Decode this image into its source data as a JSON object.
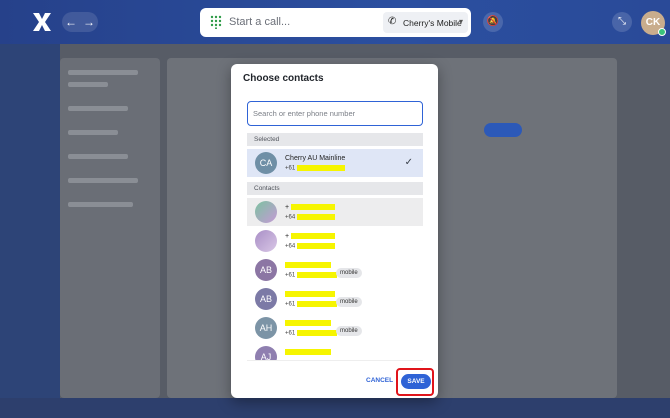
{
  "topbar": {
    "call_placeholder": "Start a call...",
    "line_label": "Cherry's Mobile",
    "user_initials": "CK",
    "icons": [
      "x-logo-icon",
      "back-arrow-icon",
      "forward-arrow-icon",
      "dialpad-icon",
      "phone-icon",
      "chevron-down-icon",
      "bell-off-icon",
      "collapse-icon"
    ]
  },
  "dialog": {
    "title": "Choose contacts",
    "search_placeholder": "Search or enter phone number",
    "selected_header": "Selected",
    "contacts_header": "Contacts",
    "selected": [
      {
        "initials": "CA",
        "name": "Cherry AU Mainline",
        "number_prefix": "+61",
        "checked": true
      }
    ],
    "contacts": [
      {
        "initials": "",
        "name_prefix": "+",
        "number_prefix": "+64",
        "badge": ""
      },
      {
        "initials": "",
        "name_prefix": "+",
        "number_prefix": "+64",
        "badge": ""
      },
      {
        "initials": "AB",
        "name_prefix": "",
        "number_prefix": "+61",
        "badge": "mobile"
      },
      {
        "initials": "AB",
        "name_prefix": "",
        "number_prefix": "+61",
        "badge": "mobile"
      },
      {
        "initials": "AH",
        "name_prefix": "",
        "number_prefix": "+61",
        "badge": "mobile"
      },
      {
        "initials": "AJ",
        "name_prefix": "",
        "number_prefix": "",
        "badge": ""
      }
    ],
    "cancel_label": "CANCEL",
    "save_label": "SAVE"
  },
  "colors": {
    "accent": "#2f63d6",
    "highlight_box": "#e0141b",
    "redaction": "#f6f500"
  }
}
